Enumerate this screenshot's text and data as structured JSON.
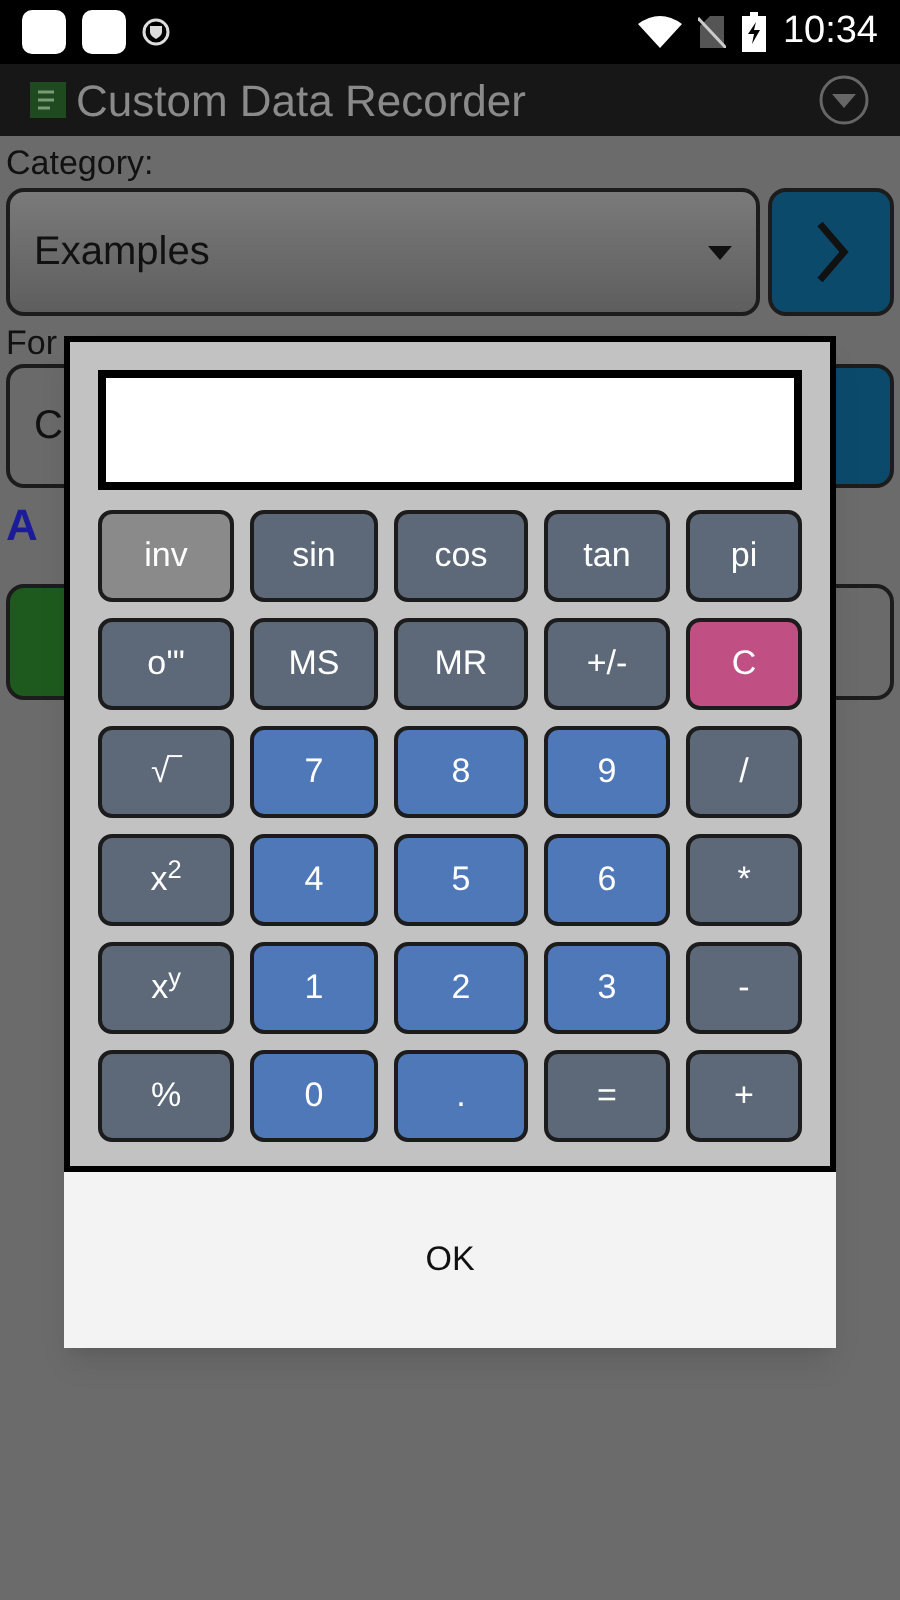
{
  "status_bar": {
    "time": "10:34"
  },
  "app_bar": {
    "title": "Custom Data Recorder"
  },
  "category": {
    "label": "Category:",
    "value": "Examples"
  },
  "form": {
    "label": "For",
    "value": "C"
  },
  "link_text": "A",
  "dialog": {
    "keys": [
      [
        {
          "label": "inv",
          "kind": "toggle"
        },
        {
          "label": "sin",
          "kind": "function"
        },
        {
          "label": "cos",
          "kind": "function"
        },
        {
          "label": "tan",
          "kind": "function"
        },
        {
          "label": "pi",
          "kind": "function"
        }
      ],
      [
        {
          "label": "o'\"",
          "kind": "function"
        },
        {
          "label": "MS",
          "kind": "function"
        },
        {
          "label": "MR",
          "kind": "function"
        },
        {
          "label": "+/-",
          "kind": "function"
        },
        {
          "label": "C",
          "kind": "clear"
        }
      ],
      [
        {
          "label": "√‾",
          "kind": "function"
        },
        {
          "label": "7",
          "kind": "digit"
        },
        {
          "label": "8",
          "kind": "digit"
        },
        {
          "label": "9",
          "kind": "digit"
        },
        {
          "label": "/",
          "kind": "function"
        }
      ],
      [
        {
          "label": "x$^{2}$",
          "kind": "function"
        },
        {
          "label": "4",
          "kind": "digit"
        },
        {
          "label": "5",
          "kind": "digit"
        },
        {
          "label": "6",
          "kind": "digit"
        },
        {
          "label": "*",
          "kind": "function"
        }
      ],
      [
        {
          "label": "x$^{y}$",
          "kind": "function"
        },
        {
          "label": "1",
          "kind": "digit"
        },
        {
          "label": "2",
          "kind": "digit"
        },
        {
          "label": "3",
          "kind": "digit"
        },
        {
          "label": "-",
          "kind": "function"
        }
      ],
      [
        {
          "label": "%",
          "kind": "function"
        },
        {
          "label": "0",
          "kind": "digit"
        },
        {
          "label": ".",
          "kind": "digit"
        },
        {
          "label": "=",
          "kind": "function"
        },
        {
          "label": "+",
          "kind": "function"
        }
      ]
    ],
    "ok_button": "OK"
  }
}
